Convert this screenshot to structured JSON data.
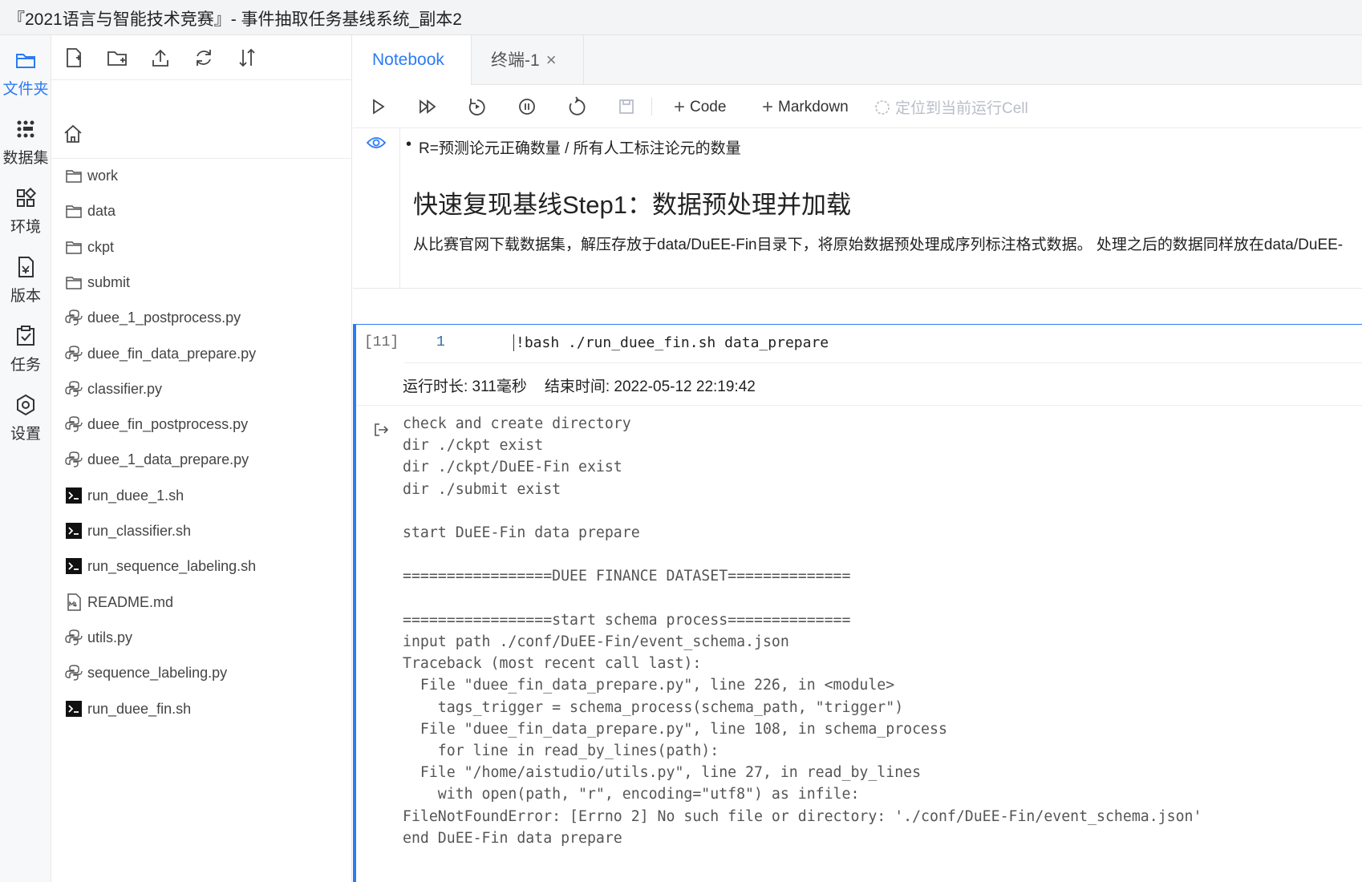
{
  "window": {
    "title": "『2021语言与智能技术竞赛』- 事件抽取任务基线系统_副本2"
  },
  "leftnav": {
    "items": [
      {
        "label": "文件夹",
        "icon": "folder-icon",
        "active": true
      },
      {
        "label": "数据集",
        "icon": "dataset-icon",
        "active": false
      },
      {
        "label": "环境",
        "icon": "environment-icon",
        "active": false
      },
      {
        "label": "版本",
        "icon": "version-icon",
        "active": false
      },
      {
        "label": "任务",
        "icon": "task-icon",
        "active": false
      },
      {
        "label": "设置",
        "icon": "settings-icon",
        "active": false
      }
    ]
  },
  "filepanel": {
    "toolbar": [
      "new-file-icon",
      "new-folder-icon",
      "upload-icon",
      "refresh-icon",
      "sort-icon"
    ],
    "files": [
      {
        "name": "work",
        "type": "folder"
      },
      {
        "name": "data",
        "type": "folder"
      },
      {
        "name": "ckpt",
        "type": "folder"
      },
      {
        "name": "submit",
        "type": "folder"
      },
      {
        "name": "duee_1_postprocess.py",
        "type": "python"
      },
      {
        "name": "duee_fin_data_prepare.py",
        "type": "python"
      },
      {
        "name": "classifier.py",
        "type": "python"
      },
      {
        "name": "duee_fin_postprocess.py",
        "type": "python"
      },
      {
        "name": "duee_1_data_prepare.py",
        "type": "python"
      },
      {
        "name": "run_duee_1.sh",
        "type": "shell"
      },
      {
        "name": "run_classifier.sh",
        "type": "shell"
      },
      {
        "name": "run_sequence_labeling.sh",
        "type": "shell"
      },
      {
        "name": "README.md",
        "type": "markdown"
      },
      {
        "name": "utils.py",
        "type": "python"
      },
      {
        "name": "sequence_labeling.py",
        "type": "python"
      },
      {
        "name": "run_duee_fin.sh",
        "type": "shell"
      }
    ]
  },
  "tabs": {
    "notebook": "Notebook",
    "terminal": "终端-1",
    "close": "×"
  },
  "toolbar": {
    "code_label": "Code",
    "markdown_label": "Markdown",
    "locate_label": "定位到当前运行Cell",
    "plus": "+"
  },
  "markdown_cell": {
    "bullet": "R=预测论元正确数量 / 所有人工标注论元的数量",
    "heading": "快速复现基线Step1：数据预处理并加载",
    "paragraph": "从比赛官网下载数据集，解压存放于data/DuEE-Fin目录下，将原始数据预处理成序列标注格式数据。 处理之后的数据同样放在data/DuEE-"
  },
  "code_cell": {
    "prompt": "[11]",
    "line_number": "1",
    "code": "!bash ./run_duee_fin.sh data_prepare",
    "run_time": "运行时长: 311毫秒",
    "end_time": "结束时间: 2022-05-12 22:19:42",
    "output": "check and create directory\ndir ./ckpt exist\ndir ./ckpt/DuEE-Fin exist\ndir ./submit exist\n\nstart DuEE-Fin data prepare\n\n=================DUEE FINANCE DATASET==============\n\n=================start schema process==============\ninput path ./conf/DuEE-Fin/event_schema.json\nTraceback (most recent call last):\n  File \"duee_fin_data_prepare.py\", line 226, in <module>\n    tags_trigger = schema_process(schema_path, \"trigger\")\n  File \"duee_fin_data_prepare.py\", line 108, in schema_process\n    for line in read_by_lines(path):\n  File \"/home/aistudio/utils.py\", line 27, in read_by_lines\n    with open(path, \"r\", encoding=\"utf8\") as infile:\nFileNotFoundError: [Errno 2] No such file or directory: './conf/DuEE-Fin/event_schema.json'\nend DuEE-Fin data prepare"
  },
  "colors": {
    "accent": "#2b7bf5",
    "disabled": "#b8bec8"
  }
}
